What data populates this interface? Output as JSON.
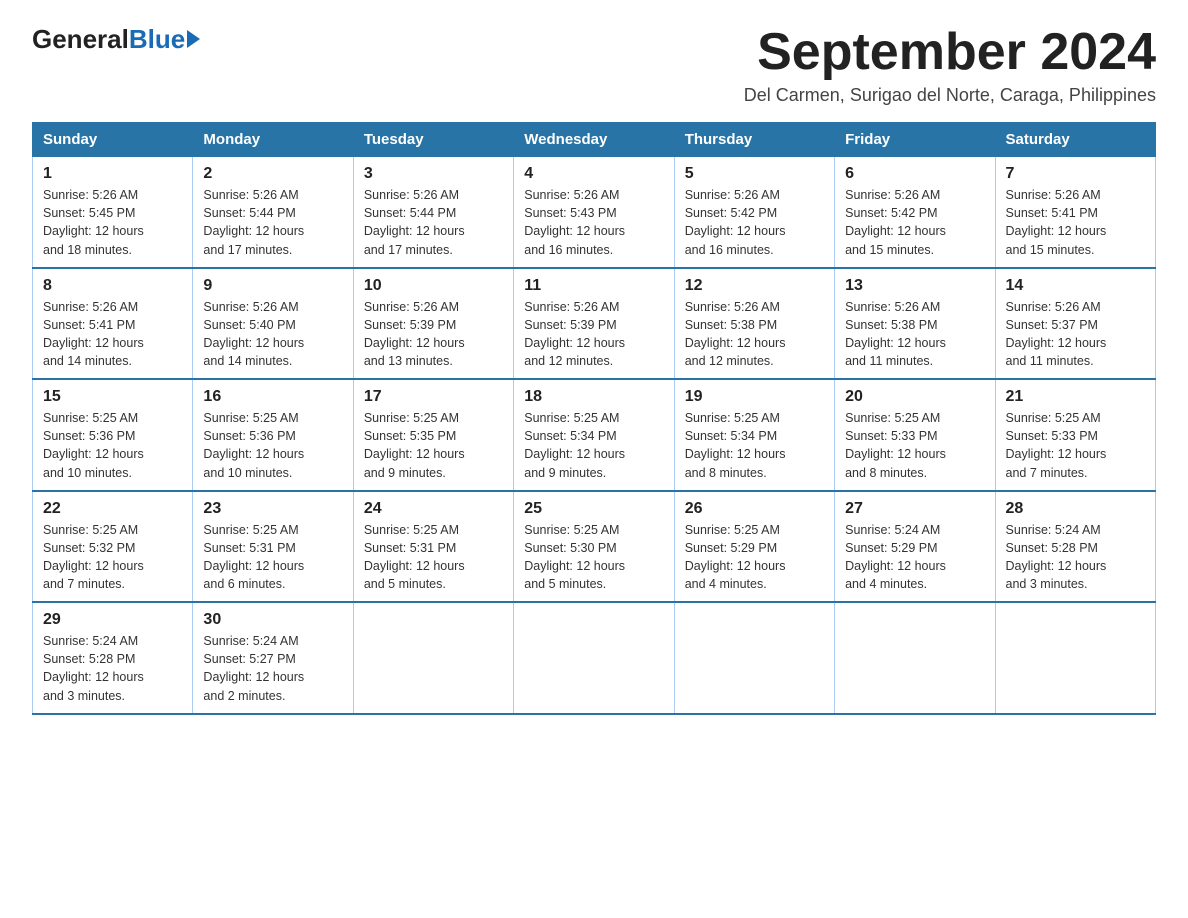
{
  "logo": {
    "general": "General",
    "blue": "Blue"
  },
  "title": "September 2024",
  "subtitle": "Del Carmen, Surigao del Norte, Caraga, Philippines",
  "headers": [
    "Sunday",
    "Monday",
    "Tuesday",
    "Wednesday",
    "Thursday",
    "Friday",
    "Saturday"
  ],
  "weeks": [
    [
      {
        "day": "1",
        "sunrise": "5:26 AM",
        "sunset": "5:45 PM",
        "daylight": "12 hours and 18 minutes."
      },
      {
        "day": "2",
        "sunrise": "5:26 AM",
        "sunset": "5:44 PM",
        "daylight": "12 hours and 17 minutes."
      },
      {
        "day": "3",
        "sunrise": "5:26 AM",
        "sunset": "5:44 PM",
        "daylight": "12 hours and 17 minutes."
      },
      {
        "day": "4",
        "sunrise": "5:26 AM",
        "sunset": "5:43 PM",
        "daylight": "12 hours and 16 minutes."
      },
      {
        "day": "5",
        "sunrise": "5:26 AM",
        "sunset": "5:42 PM",
        "daylight": "12 hours and 16 minutes."
      },
      {
        "day": "6",
        "sunrise": "5:26 AM",
        "sunset": "5:42 PM",
        "daylight": "12 hours and 15 minutes."
      },
      {
        "day": "7",
        "sunrise": "5:26 AM",
        "sunset": "5:41 PM",
        "daylight": "12 hours and 15 minutes."
      }
    ],
    [
      {
        "day": "8",
        "sunrise": "5:26 AM",
        "sunset": "5:41 PM",
        "daylight": "12 hours and 14 minutes."
      },
      {
        "day": "9",
        "sunrise": "5:26 AM",
        "sunset": "5:40 PM",
        "daylight": "12 hours and 14 minutes."
      },
      {
        "day": "10",
        "sunrise": "5:26 AM",
        "sunset": "5:39 PM",
        "daylight": "12 hours and 13 minutes."
      },
      {
        "day": "11",
        "sunrise": "5:26 AM",
        "sunset": "5:39 PM",
        "daylight": "12 hours and 12 minutes."
      },
      {
        "day": "12",
        "sunrise": "5:26 AM",
        "sunset": "5:38 PM",
        "daylight": "12 hours and 12 minutes."
      },
      {
        "day": "13",
        "sunrise": "5:26 AM",
        "sunset": "5:38 PM",
        "daylight": "12 hours and 11 minutes."
      },
      {
        "day": "14",
        "sunrise": "5:26 AM",
        "sunset": "5:37 PM",
        "daylight": "12 hours and 11 minutes."
      }
    ],
    [
      {
        "day": "15",
        "sunrise": "5:25 AM",
        "sunset": "5:36 PM",
        "daylight": "12 hours and 10 minutes."
      },
      {
        "day": "16",
        "sunrise": "5:25 AM",
        "sunset": "5:36 PM",
        "daylight": "12 hours and 10 minutes."
      },
      {
        "day": "17",
        "sunrise": "5:25 AM",
        "sunset": "5:35 PM",
        "daylight": "12 hours and 9 minutes."
      },
      {
        "day": "18",
        "sunrise": "5:25 AM",
        "sunset": "5:34 PM",
        "daylight": "12 hours and 9 minutes."
      },
      {
        "day": "19",
        "sunrise": "5:25 AM",
        "sunset": "5:34 PM",
        "daylight": "12 hours and 8 minutes."
      },
      {
        "day": "20",
        "sunrise": "5:25 AM",
        "sunset": "5:33 PM",
        "daylight": "12 hours and 8 minutes."
      },
      {
        "day": "21",
        "sunrise": "5:25 AM",
        "sunset": "5:33 PM",
        "daylight": "12 hours and 7 minutes."
      }
    ],
    [
      {
        "day": "22",
        "sunrise": "5:25 AM",
        "sunset": "5:32 PM",
        "daylight": "12 hours and 7 minutes."
      },
      {
        "day": "23",
        "sunrise": "5:25 AM",
        "sunset": "5:31 PM",
        "daylight": "12 hours and 6 minutes."
      },
      {
        "day": "24",
        "sunrise": "5:25 AM",
        "sunset": "5:31 PM",
        "daylight": "12 hours and 5 minutes."
      },
      {
        "day": "25",
        "sunrise": "5:25 AM",
        "sunset": "5:30 PM",
        "daylight": "12 hours and 5 minutes."
      },
      {
        "day": "26",
        "sunrise": "5:25 AM",
        "sunset": "5:29 PM",
        "daylight": "12 hours and 4 minutes."
      },
      {
        "day": "27",
        "sunrise": "5:24 AM",
        "sunset": "5:29 PM",
        "daylight": "12 hours and 4 minutes."
      },
      {
        "day": "28",
        "sunrise": "5:24 AM",
        "sunset": "5:28 PM",
        "daylight": "12 hours and 3 minutes."
      }
    ],
    [
      {
        "day": "29",
        "sunrise": "5:24 AM",
        "sunset": "5:28 PM",
        "daylight": "12 hours and 3 minutes."
      },
      {
        "day": "30",
        "sunrise": "5:24 AM",
        "sunset": "5:27 PM",
        "daylight": "12 hours and 2 minutes."
      },
      null,
      null,
      null,
      null,
      null
    ]
  ],
  "labels": {
    "sunrise": "Sunrise:",
    "sunset": "Sunset:",
    "daylight": "Daylight:"
  }
}
